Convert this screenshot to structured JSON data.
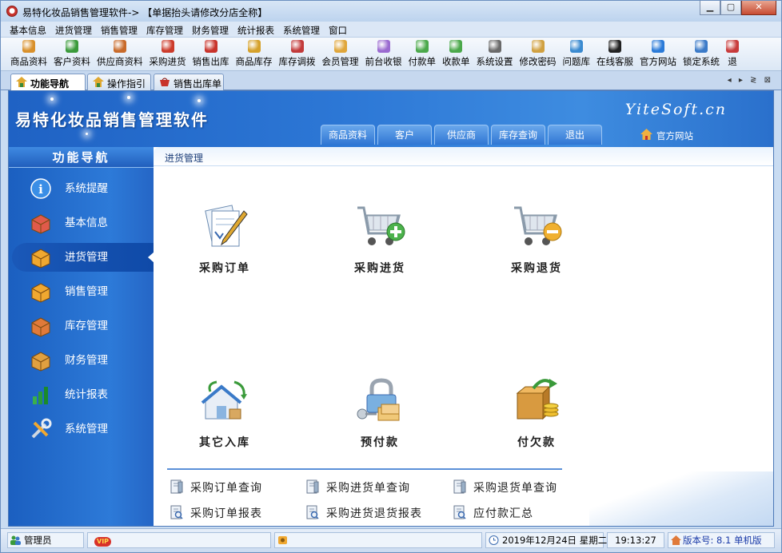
{
  "window": {
    "title": "易特化妆品销售管理软件-> 【单据抬头请修改分店全称】",
    "buttons": {
      "minimize": "▁",
      "maximize": "▢",
      "close": "✕"
    }
  },
  "menu": [
    "基本信息",
    "进货管理",
    "销售管理",
    "库存管理",
    "财务管理",
    "统计报表",
    "系统管理",
    "窗口"
  ],
  "toolbar": [
    {
      "label": "商品资料",
      "icon": "products-icon",
      "color": "#d9902a"
    },
    {
      "label": "客户资料",
      "icon": "customers-icon",
      "color": "#3a9a3a"
    },
    {
      "label": "供应商资料",
      "icon": "suppliers-icon",
      "color": "#c86a2a"
    },
    {
      "label": "采购进货",
      "icon": "truck-icon",
      "color": "#cc3b2b"
    },
    {
      "label": "销售出库",
      "icon": "basket-icon",
      "color": "#c8322a"
    },
    {
      "label": "商品库存",
      "icon": "box-icon",
      "color": "#d5a12a"
    },
    {
      "label": "库存调拨",
      "icon": "transfer-icon",
      "color": "#c23a3a"
    },
    {
      "label": "会员管理",
      "icon": "member-icon",
      "color": "#e0a63a"
    },
    {
      "label": "前台收银",
      "icon": "cashier-icon",
      "color": "#9a6ad0"
    },
    {
      "label": "付款单",
      "icon": "payment-icon",
      "color": "#4aa84a"
    },
    {
      "label": "收款单",
      "icon": "receipt-icon",
      "color": "#4aa84a"
    },
    {
      "label": "系统设置",
      "icon": "settings-icon",
      "color": "#6a6a6a"
    },
    {
      "label": "修改密码",
      "icon": "password-icon",
      "color": "#d0a040"
    },
    {
      "label": "问题库",
      "icon": "faq-icon",
      "color": "#3a8ad0"
    },
    {
      "label": "在线客服",
      "icon": "chat-icon",
      "color": "#222222"
    },
    {
      "label": "官方网站",
      "icon": "browser-icon",
      "color": "#2a7ad8"
    },
    {
      "label": "锁定系统",
      "icon": "lock-icon",
      "color": "#3a7ac8"
    },
    {
      "label": "退",
      "icon": "exit-icon",
      "color": "#c83a3a"
    }
  ],
  "tabs": [
    {
      "label": "功能导航",
      "active": true
    },
    {
      "label": "操作指引",
      "active": false
    },
    {
      "label": "销售出库单",
      "active": false
    }
  ],
  "tab_nav": "◂ ▸ ≷ ⊠",
  "banner": {
    "brand": "易特化妆品销售管理软件",
    "logo": "YiteSoft.cn",
    "official_site": "官方网站",
    "nav": [
      "商品资料",
      "客户",
      "供应商",
      "库存查询",
      "退出"
    ]
  },
  "sidebar": {
    "title": "功能导航",
    "items": [
      {
        "label": "系统提醒",
        "active": false,
        "color": "#3a8ee6"
      },
      {
        "label": "基本信息",
        "active": false,
        "color": "#e05a4a"
      },
      {
        "label": "进货管理",
        "active": true,
        "color": "#f0a830"
      },
      {
        "label": "销售管理",
        "active": false,
        "color": "#f0a830"
      },
      {
        "label": "库存管理",
        "active": false,
        "color": "#e07a3a"
      },
      {
        "label": "财务管理",
        "active": false,
        "color": "#e0a040"
      },
      {
        "label": "统计报表",
        "active": false,
        "color": "#3ab04a"
      },
      {
        "label": "系统管理",
        "active": false,
        "color": "#d0d8e0"
      }
    ]
  },
  "main": {
    "breadcrumb": "进货管理",
    "features": [
      {
        "label": "采购订单",
        "icon": "purchase-order-icon"
      },
      {
        "label": "采购进货",
        "icon": "cart-add-icon"
      },
      {
        "label": "采购退货",
        "icon": "cart-remove-icon"
      },
      {
        "label": "其它入库",
        "icon": "warehouse-in-icon"
      },
      {
        "label": "预付款",
        "icon": "prepay-icon"
      },
      {
        "label": "付欠款",
        "icon": "pay-debt-icon"
      }
    ],
    "reports": [
      "采购订单查询",
      "采购进货单查询",
      "采购退货单查询",
      "采购订单报表",
      "采购进货退货报表",
      "应付款汇总"
    ]
  },
  "status": {
    "user": "管理员",
    "vip": "VIP",
    "date": "2019年12月24日 星期二",
    "time": "19:13:27",
    "version": "版本号: 8.1 单机版"
  }
}
